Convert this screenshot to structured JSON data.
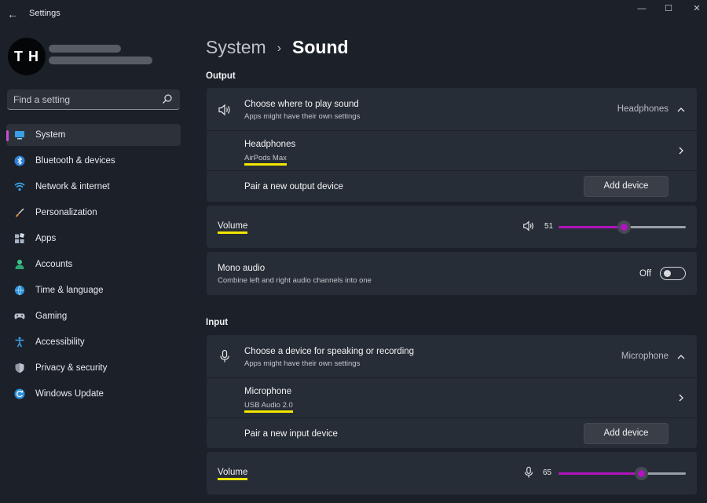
{
  "window": {
    "title": "Settings",
    "back_glyph": "←",
    "minimize_glyph": "—",
    "maximize_glyph": "☐",
    "close_glyph": "✕"
  },
  "user": {
    "avatar_initials": "T H"
  },
  "search": {
    "placeholder": "Find a setting",
    "icon": "search-icon"
  },
  "nav": {
    "accent_color": "#c64fd3",
    "items": [
      {
        "label": "System",
        "icon": "system-icon",
        "active": true
      },
      {
        "label": "Bluetooth & devices",
        "icon": "bluetooth-icon"
      },
      {
        "label": "Network & internet",
        "icon": "network-icon"
      },
      {
        "label": "Personalization",
        "icon": "personalization-icon"
      },
      {
        "label": "Apps",
        "icon": "apps-icon"
      },
      {
        "label": "Accounts",
        "icon": "accounts-icon"
      },
      {
        "label": "Time & language",
        "icon": "time-language-icon"
      },
      {
        "label": "Gaming",
        "icon": "gaming-icon"
      },
      {
        "label": "Accessibility",
        "icon": "accessibility-icon"
      },
      {
        "label": "Privacy & security",
        "icon": "privacy-icon"
      },
      {
        "label": "Windows Update",
        "icon": "windows-update-icon"
      }
    ]
  },
  "breadcrumb": {
    "parent": "System",
    "separator": "›",
    "current": "Sound"
  },
  "output": {
    "heading": "Output",
    "choose": {
      "title": "Choose where to play sound",
      "subtitle": "Apps might have their own settings",
      "value": "Headphones"
    },
    "device": {
      "name": "Headphones",
      "detail": "AirPods Max"
    },
    "pair": {
      "label": "Pair a new output device",
      "button": "Add device"
    },
    "volume": {
      "label": "Volume",
      "value": "51",
      "level": 0.51
    },
    "mono": {
      "title": "Mono audio",
      "subtitle": "Combine left and right audio channels into one",
      "state": "Off"
    }
  },
  "input": {
    "heading": "Input",
    "choose": {
      "title": "Choose a device for speaking or recording",
      "subtitle": "Apps might have their own settings",
      "value": "Microphone"
    },
    "device": {
      "name": "Microphone",
      "detail": "USB Audio 2.0"
    },
    "pair": {
      "label": "Pair a new input device",
      "button": "Add device"
    },
    "volume": {
      "label": "Volume",
      "value": "65",
      "level": 0.65
    }
  },
  "colors": {
    "accent": "#b014be",
    "highlight": "#f3e600"
  }
}
